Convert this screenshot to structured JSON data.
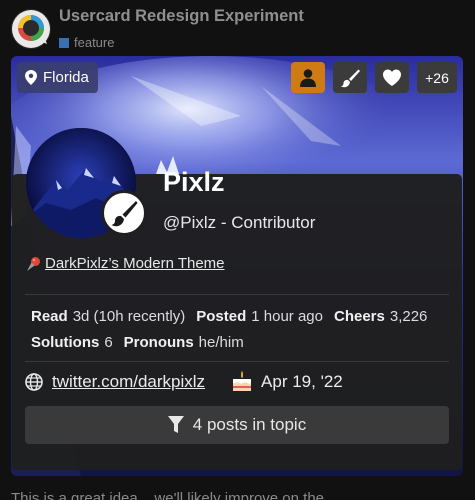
{
  "topic": {
    "title": "Usercard Redesign Experiment",
    "category": "feature",
    "category_color": "#3a6fb3"
  },
  "site_logo_icon": "chat-bubble-logo-icon",
  "user_card": {
    "location": "Florida",
    "badges": [
      {
        "icon": "user-icon",
        "color": "#cf7b14"
      },
      {
        "icon": "paintbrush-icon",
        "color": "#3b3b3b"
      },
      {
        "icon": "heart-icon",
        "color": "#3b3b3b"
      }
    ],
    "more_badges": "+26",
    "name": "Pixlz",
    "handle": "@Pixlz - Contributor",
    "flair_icon": "paintbrush-icon",
    "featured_topic": "DarkPixlz’s Modern Theme",
    "stats": {
      "read_label": "Read",
      "read_value": "3d (10h recently)",
      "posted_label": "Posted",
      "posted_value": "1 hour ago",
      "cheers_label": "Cheers",
      "cheers_value": "3,226",
      "solutions_label": "Solutions",
      "solutions_value": "6",
      "pronouns_label": "Pronouns",
      "pronouns_value": "he/him"
    },
    "website": "twitter.com/darkpixlz",
    "birthday": "Apr 19, '22",
    "posts_button": "4 posts in topic"
  },
  "bottom_text": "This is a great idea... we'll likely improve on the..."
}
